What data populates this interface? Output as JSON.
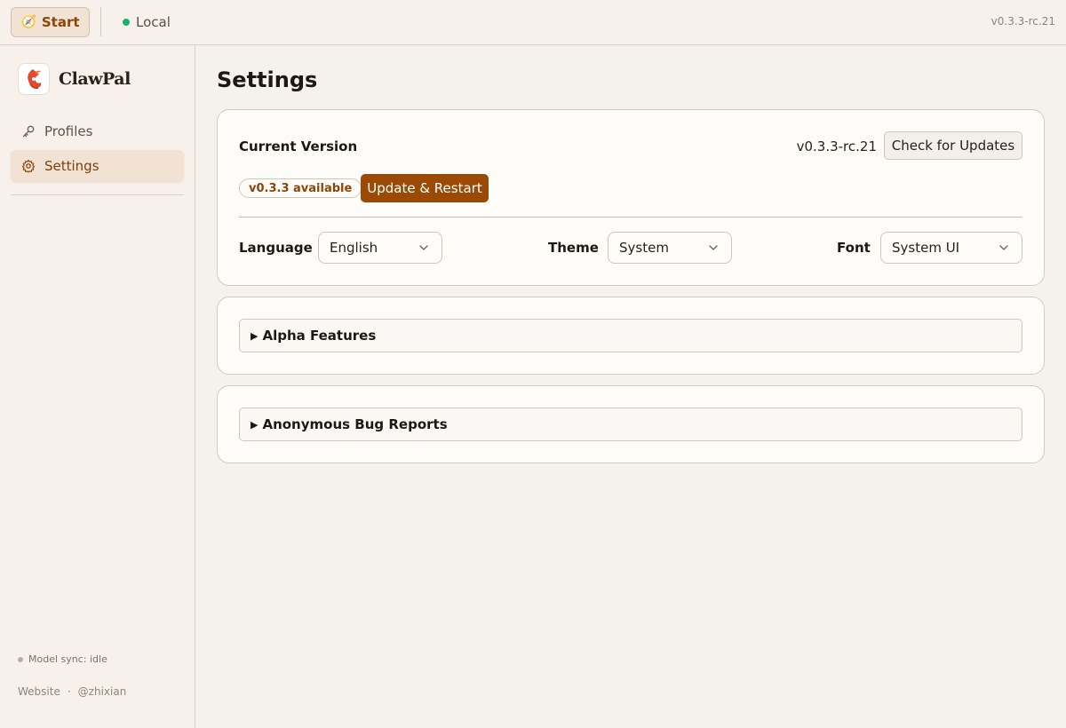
{
  "topbar": {
    "start_label": "Start",
    "start_icon": "compass-icon",
    "connection_label": "Local",
    "connection_status_color": "#1bb26b",
    "version": "v0.3.3-rc.21"
  },
  "sidebar": {
    "brand": "ClawPal",
    "items": [
      {
        "label": "Profiles",
        "icon": "key-icon",
        "active": false
      },
      {
        "label": "Settings",
        "icon": "gear-icon",
        "active": true
      }
    ],
    "model_sync": "Model sync: idle",
    "links": {
      "website": "Website",
      "separator": "·",
      "handle": "@zhixian"
    }
  },
  "main": {
    "title": "Settings",
    "version_card": {
      "current_version_label": "Current Version",
      "current_version_value": "v0.3.3-rc.21",
      "check_button": "Check for Updates",
      "available_badge": "v0.3.3 available",
      "update_button": "Update & Restart",
      "language": {
        "label": "Language",
        "value": "English"
      },
      "theme": {
        "label": "Theme",
        "value": "System"
      },
      "font": {
        "label": "Font",
        "value": "System UI"
      }
    },
    "alpha_features": "Alpha Features",
    "bug_reports": "Anonymous Bug Reports"
  },
  "colors": {
    "accent": "#9a4a04",
    "active_nav_bg": "#f1e2d4",
    "background": "#f5f1ec"
  }
}
